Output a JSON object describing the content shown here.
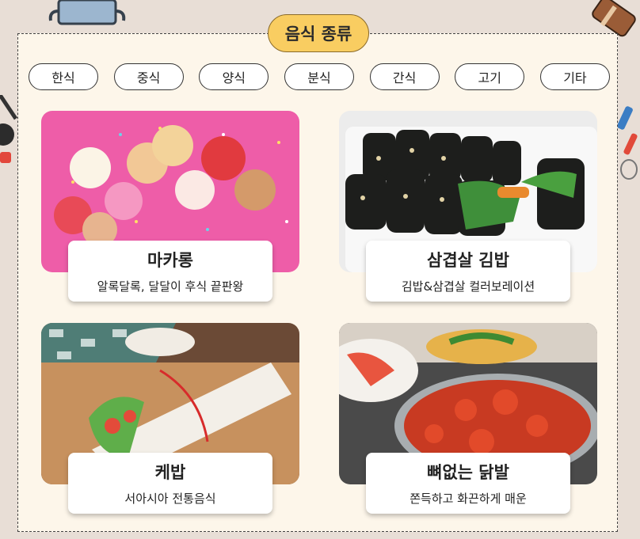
{
  "section": {
    "title": "음식 종류"
  },
  "tabs": [
    {
      "label": "한식"
    },
    {
      "label": "중식"
    },
    {
      "label": "양식"
    },
    {
      "label": "분식"
    },
    {
      "label": "간식"
    },
    {
      "label": "고기"
    },
    {
      "label": "기타"
    }
  ],
  "cards": [
    {
      "name": "마카롱",
      "desc": "알록달록, 달달이 후식 끝판왕"
    },
    {
      "name": "삼겹살 김밥",
      "desc": "김밥&삼겹살 컬러보레이션"
    },
    {
      "name": "케밥",
      "desc": "서아시아 전통음식"
    },
    {
      "name": "뼈없는 닭발",
      "desc": "쫀득하고 화끈하게 매운"
    }
  ],
  "colors": {
    "page_bg": "#e8ded6",
    "panel_bg": "#fdf6ea",
    "title_pill": "#f9cd61",
    "macaron_bg": "#ee5da8"
  }
}
